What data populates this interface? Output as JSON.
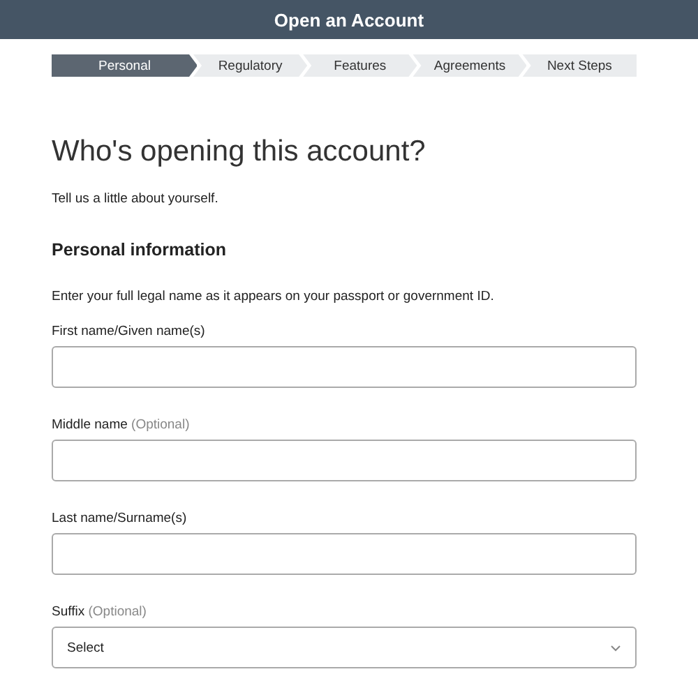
{
  "header": {
    "title": "Open an Account"
  },
  "steps": [
    {
      "label": "Personal",
      "selected": true
    },
    {
      "label": "Regulatory",
      "selected": false
    },
    {
      "label": "Features",
      "selected": false
    },
    {
      "label": "Agreements",
      "selected": false
    },
    {
      "label": "Next Steps",
      "selected": false
    }
  ],
  "heading": "Who's opening this account?",
  "subheading": "Tell us a little about yourself.",
  "section": {
    "title": "Personal information",
    "instruction": "Enter your full legal name as it appears on your passport or government ID."
  },
  "fields": [
    {
      "kind": "text",
      "label": "First name/Given name(s)"
    },
    {
      "kind": "text",
      "label": "Middle name",
      "note": "(Optional)"
    },
    {
      "kind": "text",
      "label": "Last name/Surname(s)"
    },
    {
      "kind": "select",
      "label": "Suffix",
      "note": "(Optional)",
      "value": "Select"
    }
  ]
}
